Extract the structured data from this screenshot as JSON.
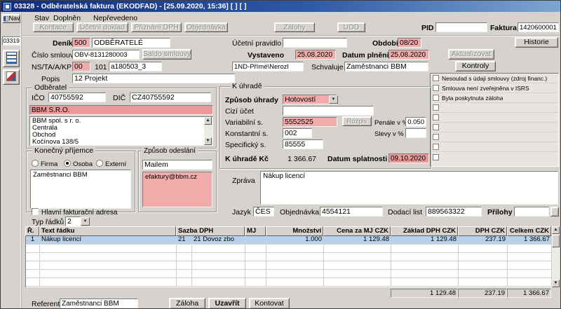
{
  "window": {
    "title": "03328 - Odběratelská faktura (EKODFAD) - [25.09.2020, 15:36]  [ ]  [ ]"
  },
  "sidebar": {
    "nav_label": "Nav",
    "form_number": "03319"
  },
  "status": {
    "stav_label": "Stav",
    "stav_value": "Doplněn",
    "prevedeno": "Nepřevedeno"
  },
  "toolbar": {
    "kontace": "Kontace",
    "ucetni_doklad": "Účetní doklad",
    "priznani_dph": "Přiznání DPH",
    "objednavka": "Objednávka",
    "zalohy": "Zálohy",
    "udd": "UDD",
    "pid_label": "PID",
    "pid_value": "",
    "faktura_label": "Faktura",
    "faktura_value": "1420600001"
  },
  "header": {
    "denik_label": "Deník",
    "denik_code": "500",
    "denik_name": "ODBĚRATELÉ",
    "ucetni_pravidlo_label": "Účetní pravidlo",
    "ucetni_pravidlo_value": "",
    "obdobi_label": "Období",
    "obdobi_value": "08/20",
    "historie_button": "Historie",
    "cislo_smlouvy_label": "Číslo smlouvy",
    "cislo_smlouvy_value": "OBV-8131280003",
    "saldo_smlouvy_button": "Saldo smlouvy",
    "vystaveno_label": "Vystaveno",
    "vystaveno_value": "25.08.2020",
    "datum_plneni_label": "Datum plnění",
    "datum_plneni_value": "25.08.2020",
    "aktualizovat_button": "Aktualizovat",
    "ns_label": "NS/TA/A/KP",
    "ns_value1": "00",
    "ns_value2": "101",
    "ns_value3": "a180503_3",
    "ns_value4": "1ND-Přímé\\Nerozl",
    "schvaluje_label": "Schvaluje",
    "schvaluje_value": "Zaměstnanci BBM",
    "kontroly_button": "Kontroly",
    "popis_label": "Popis",
    "popis_value": "12 Projekt"
  },
  "kontroly": {
    "items": [
      "Nesoulad s údaji smlouvy (zdroj financ.)",
      "Smlouva není zveřejněna v ISRS",
      "Byla poskytnuta záloha"
    ]
  },
  "odberatel": {
    "title": "Odběratel",
    "ico_label": "IČO",
    "ico_value": "40755592",
    "dic_label": "DIČ",
    "dic_value": "CZ40755592",
    "name": "BBM S.R.O.",
    "address_lines": [
      "BBM spol. s r. o.",
      "Centrála",
      "Obchod",
      "Kočínova 138/5"
    ]
  },
  "uhrada": {
    "title": "K úhradě",
    "zpusob_label": "Způsob úhrady",
    "zpusob_value": "Hotovostí",
    "cizi_ucet_label": "Cizí účet",
    "cizi_ucet_value": "",
    "variabilni_label": "Variabilní s.",
    "variabilni_value": "5552525",
    "rozpis_button": "Rozpis",
    "penale_label": "Penále v %",
    "penale_value": "0.050",
    "konstantni_label": "Konstantní s.",
    "konstantni_value": "002",
    "slevy_label": "Slevy v %",
    "slevy_value": "",
    "specificky_label": "Specifický s.",
    "specificky_value": "85555",
    "k_uhrade_label": "K úhradě Kč",
    "k_uhrade_value": "1 366.67",
    "splatnost_label": "Datum splatnosti",
    "splatnost_value": "09.10.2020"
  },
  "prijemce": {
    "title": "Konečný příjemce",
    "firma": "Firma",
    "osoba": "Osoba",
    "externi": "Externí",
    "selected": "Osoba",
    "value": "Zaměstnanci BBM"
  },
  "odeslani": {
    "title": "Způsob odeslání",
    "method": "Mailem",
    "email": "efaktury@bbm.cz"
  },
  "zprava": {
    "label": "Zpráva",
    "value": "Nákup licencí"
  },
  "misc": {
    "hlavni_adresa": "Hlavní fakturační adresa",
    "jazyk_label": "Jazyk",
    "jazyk_value": "ČES",
    "objednavka_label": "Objednávka",
    "objednavka_value": "4554121",
    "dodaci_label": "Dodací list",
    "dodaci_value": "889563322",
    "prilohy_label": "Přílohy",
    "prilohy_value": ""
  },
  "radky": {
    "label": "Typ řádků",
    "value": "2"
  },
  "table": {
    "headers": [
      "Ř.",
      "Text řádku",
      "Sazba DPH",
      "MJ",
      "Množství",
      "Cena za MJ CZK",
      "Základ DPH CZK",
      "DPH CZK",
      "Celkem CZK"
    ],
    "row1": {
      "num": "1",
      "text": "Nákup licencí",
      "sazba_code": "21",
      "sazba_name": "21 Dovoz zbo",
      "mj": "",
      "mnozstvi": "1.000",
      "cena": "1 129.48",
      "zaklad": "1 129.48",
      "dph": "237.19",
      "celkem": "1 366.67"
    },
    "totals": {
      "zaklad": "1 129.48",
      "dph": "237.19",
      "celkem": "1 366.67"
    }
  },
  "footer": {
    "referent_label": "Referent",
    "referent_value": "Zaměstnanci BBM",
    "zaloha": "Záloha",
    "uzavrit": "Uzavřít",
    "kontovat": "Kontovat"
  },
  "colors": {
    "titlebar": "#0f2b7d",
    "window_bg": "#d6d3ce",
    "required_field": "#f2abab",
    "customer_highlight": "#eb9898",
    "selected_row": "#b8d2ec"
  }
}
